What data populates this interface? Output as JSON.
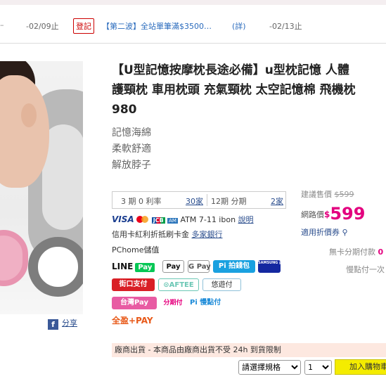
{
  "promo": {
    "dash": "–",
    "date1": "-02/09止",
    "badge": "登記",
    "text": "【第二波】全站單筆滿$3500…",
    "detail": "(詳)",
    "date2": "-02/13止"
  },
  "product": {
    "title_lines": [
      "【U型記憶按摩枕長途必備】u型枕記憶 人體",
      "護頸枕 車用枕頭 充氣頸枕 太空記憶棉 飛機枕",
      "980"
    ],
    "features": [
      "記憶海綿",
      "柔軟舒適",
      "解放脖子"
    ],
    "share_label": "分享"
  },
  "installment": {
    "plan1": "3 期 0 利率",
    "plan1_link": "30家",
    "plan2": "12期 分期",
    "plan2_link": "2家"
  },
  "payment": {
    "visa": "VISA",
    "atm_text": "ATM 7-11 ibon",
    "explain_link": "說明",
    "credit_text": "信用卡紅利折抵刷卡金",
    "banks_link": "多家銀行",
    "stored_value": "PChome儲值",
    "logos": {
      "line": "LINE",
      "line_pay": "Pay",
      "apple_pay": "Pay",
      "google_pay": "G Pay",
      "pi": "Pi 拍錢包",
      "samsung_pay": "SAMSUNG pay",
      "jko": "街口支付",
      "taiwan_pay_wallet": "⊙AFTEE",
      "easywallet": "悠遊付",
      "taiwan_pay": "台灣Pay",
      "icash": "全盈+PAY",
      "slowpay": "Pi 慢點付",
      "allpay": "全盈+PAY",
      "yuan_pay": "分期付"
    }
  },
  "price": {
    "list_label": "建議售價",
    "list_value": "$599",
    "web_label": "網路價",
    "currency": "$",
    "web_value": "599",
    "coupon": "適用折價券"
  },
  "nocard": "無卡分期付款",
  "nocard_mark": "0",
  "slowpay_text": "慢點付一次",
  "ship_notice": "廠商出貨 - 本商品由廠商出貨不受 24h 到貨限制",
  "controls": {
    "spec_placeholder": "請選擇規格",
    "qty": "1",
    "cart_label": "加入購物車"
  },
  "colors": {
    "price_pink": "#e3007f",
    "link_blue": "#2a4d8d",
    "cart_yellow": "#f4ec00"
  }
}
